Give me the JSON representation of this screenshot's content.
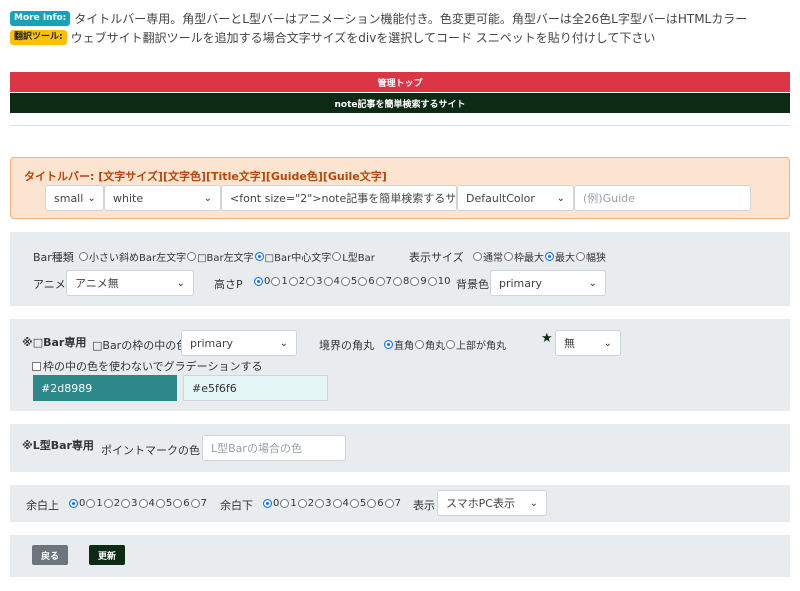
{
  "info": {
    "more_badge": "More Info:",
    "more_text": "タイトルバー専用。角型バーとL型バーはアニメーション機能付き。色変更可能。角型バーは全26色L字型バーはHTMLカラー",
    "translate_badge": "翻訳ツール:",
    "translate_text": "ウェブサイト翻訳ツールを追加する場合文字サイズをdivを選択してコード スニペットを貼り付けして下さい"
  },
  "preview": {
    "top_bar": "管理トップ",
    "title_bar": "note記事を簡単検索するサイト"
  },
  "titlebar": {
    "heading": "タイトルバー: [文字サイズ][文字色][Title文字][Guide色][Guile文字]",
    "size_value": "small",
    "color_value": "white",
    "title_value": "<font size=\"2\">note記事を簡単検索するサ-",
    "guide_color_value": "DefaultColor",
    "guide_placeholder": "(例)Guide"
  },
  "bar": {
    "type_label": "Bar種類",
    "type_options": [
      "小さい斜めBar左文字",
      "□Bar左文字",
      "□Bar中心文字",
      "L型Bar"
    ],
    "type_selected": 2,
    "display_size_label": "表示サイズ",
    "display_size_options": [
      "通常",
      "枠最大",
      "最大",
      "幅狭"
    ],
    "display_size_selected": 2,
    "anime_label": "アニメ",
    "anime_value": "アニメ無",
    "height_label": "高さP",
    "height_options": [
      "0",
      "1",
      "2",
      "3",
      "4",
      "5",
      "6",
      "7",
      "8",
      "9",
      "10"
    ],
    "height_selected": 0,
    "bg_label": "背景色",
    "bg_value": "primary"
  },
  "square": {
    "heading": "※□Bar専用",
    "inner_color_label": "□Barの枠の中の色",
    "inner_color_value": "primary",
    "corner_label": "境界の角丸",
    "corner_options": [
      "直角",
      "角丸",
      "上部が角丸"
    ],
    "corner_selected": 0,
    "star_value": "無",
    "gradient_label": "枠の中の色を使わないでグラデーションする",
    "color1": "#2d8989",
    "color2": "#e5f6f6"
  },
  "lbar": {
    "heading": "※L型Bar専用",
    "point_label": "ポイントマークの色",
    "point_placeholder": "L型Barの場合の色"
  },
  "margin": {
    "top_label": "余白上",
    "top_options": [
      "0",
      "1",
      "2",
      "3",
      "4",
      "5",
      "6",
      "7"
    ],
    "top_selected": 0,
    "bottom_label": "余白下",
    "bottom_options": [
      "0",
      "1",
      "2",
      "3",
      "4",
      "5",
      "6",
      "7"
    ],
    "bottom_selected": 0,
    "display_label": "表示",
    "display_value": "スマホPC表示"
  },
  "buttons": {
    "back": "戻る",
    "update": "更新"
  },
  "colors": {
    "red": "#dc3545",
    "dark_green": "#0d2a14",
    "teal": "#2d8989",
    "light_teal": "#e5f6f6",
    "back_btn": "#6c757d"
  }
}
